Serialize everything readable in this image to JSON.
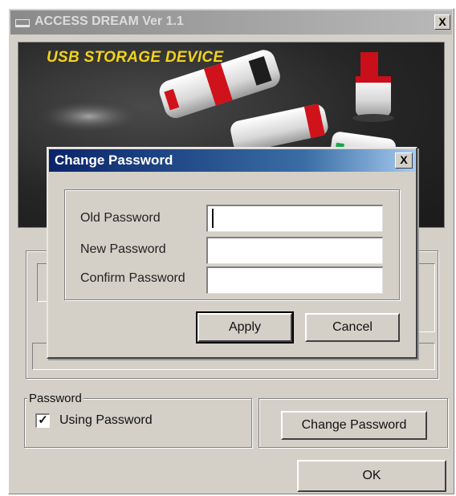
{
  "main_window": {
    "title": "ACCESS DREAM Ver 1.1",
    "close_glyph": "X"
  },
  "banner": {
    "caption": "USB STORAGE DEVICE",
    "image_name": "usb-storage-devices-photo"
  },
  "password_group": {
    "label": "Password",
    "checkbox_label": "Using Password",
    "checkbox_checked": true,
    "checkbox_glyph": "✓",
    "change_password_button": "Change Password"
  },
  "ok_button": "OK",
  "dialog": {
    "title": "Change Password",
    "close_glyph": "X",
    "fields": {
      "old_password_label": "Old Password",
      "new_password_label": "New Password",
      "confirm_password_label": "Confirm Password",
      "old_password_value": "",
      "new_password_value": "",
      "confirm_password_value": ""
    },
    "apply_button": "Apply",
    "cancel_button": "Cancel"
  },
  "colors": {
    "dialog_title_gradient_start": "#0a246a",
    "window_face": "#d4d0c8",
    "banner_caption": "#f2d31b",
    "device_red": "#d0121b"
  }
}
